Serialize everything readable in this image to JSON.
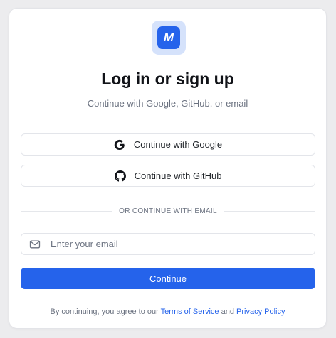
{
  "brand": {
    "logo_letter": "M",
    "accent_color": "#2563eb",
    "logo_bg_color": "#d5e2fb"
  },
  "header": {
    "title": "Log in or sign up",
    "subtitle": "Continue with Google, GitHub, or email"
  },
  "oauth": {
    "google_label": "Continue with Google",
    "google_icon": "google-icon",
    "github_label": "Continue with GitHub",
    "github_icon": "github-icon"
  },
  "divider": {
    "label": "OR CONTINUE WITH EMAIL"
  },
  "email": {
    "placeholder": "Enter your email",
    "value": "",
    "icon": "mail-icon"
  },
  "form": {
    "submit_label": "Continue"
  },
  "footer": {
    "prefix": "By continuing, you agree to our",
    "terms_label": "Terms of Service",
    "conjunction": "and",
    "privacy_label": "Privacy Policy"
  }
}
